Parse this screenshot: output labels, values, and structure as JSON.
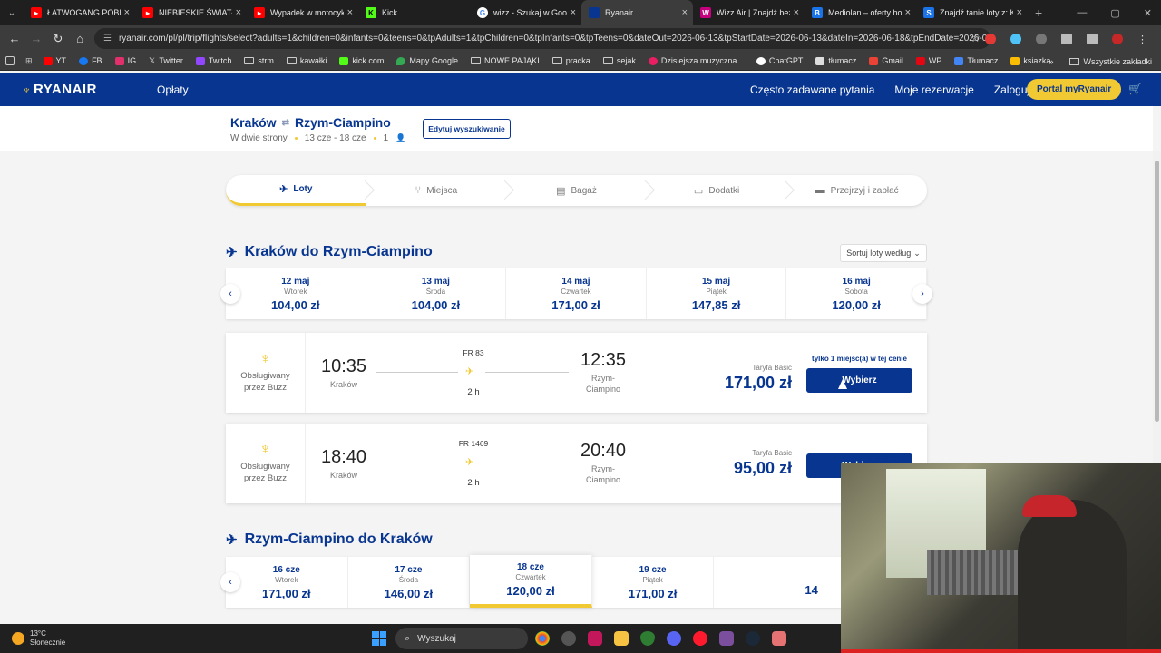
{
  "browser": {
    "tabs": [
      {
        "title": "ŁATWOGANG POBIŁ",
        "icon": "youtube-icon",
        "color": "#ff0000"
      },
      {
        "title": "NIEBIESKIE ŚWIATŁO",
        "icon": "youtube-icon",
        "color": "#ff0000"
      },
      {
        "title": "Wypadek w motocykl",
        "icon": "youtube-icon",
        "color": "#ff0000"
      },
      {
        "title": "Kick",
        "icon": "kick-icon",
        "color": "#53fc18"
      },
      {
        "title": "wizz - Szukaj w Goog",
        "icon": "google-icon",
        "color": "#ffffff"
      },
      {
        "title": "Ryanair",
        "icon": "ryanair-icon",
        "color": "#073590",
        "active": true
      },
      {
        "title": "Wizz Air | Znajdź bez",
        "icon": "wizzair-icon",
        "color": "#c6007e"
      },
      {
        "title": "Mediolan – oferty ho",
        "icon": "booking-icon",
        "color": "#1a73e8"
      },
      {
        "title": "Znajdź tanie loty z: K",
        "icon": "skyscanner-icon",
        "color": "#1a73e8"
      }
    ],
    "url": "ryanair.com/pl/pl/trip/flights/select?adults=1&children=0&infants=0&teens=0&tpAdults=1&tpChildren=0&tpInfants=0&tpTeens=0&dateOut=2026-06-13&tpStartDate=2026-06-13&dateIn=2026-06-18&tpEndDate=2026-0...",
    "bookmarks": [
      {
        "label": "YT",
        "icon": "youtube-icon",
        "color": "#ff0000"
      },
      {
        "label": "FB",
        "icon": "facebook-icon",
        "color": "#1877f2"
      },
      {
        "label": "IG",
        "icon": "instagram-icon",
        "color": "#e1306c"
      },
      {
        "label": "Twitter",
        "icon": "x-icon",
        "color": "#ffffff"
      },
      {
        "label": "Twitch",
        "icon": "twitch-icon",
        "color": "#9146ff"
      },
      {
        "label": "strm",
        "icon": "folder-icon",
        "color": ""
      },
      {
        "label": "kawałki",
        "icon": "folder-icon",
        "color": ""
      },
      {
        "label": "kick.com",
        "icon": "kick-icon",
        "color": "#53fc18"
      },
      {
        "label": "Mapy Google",
        "icon": "maps-icon",
        "color": "#34a853"
      },
      {
        "label": "NOWE PAJĄKI",
        "icon": "folder-icon",
        "color": ""
      },
      {
        "label": "pracka",
        "icon": "folder-icon",
        "color": ""
      },
      {
        "label": "sejak",
        "icon": "folder-icon",
        "color": ""
      },
      {
        "label": "Dzisiejsza muzyczna...",
        "icon": "music-icon",
        "color": "#e91e63"
      },
      {
        "label": "ChatGPT",
        "icon": "chatgpt-icon",
        "color": "#ffffff"
      },
      {
        "label": "tłumacz",
        "icon": "translate-icon",
        "color": "#ffffff"
      },
      {
        "label": "Gmail",
        "icon": "gmail-icon",
        "color": "#ea4335"
      },
      {
        "label": "WP",
        "icon": "wp-icon",
        "color": "#e30613"
      },
      {
        "label": "Tłumacz",
        "icon": "translate-icon",
        "color": "#4285f4"
      },
      {
        "label": "ksiazka",
        "icon": "book-icon",
        "color": "#fbbc04"
      }
    ],
    "all_bookmarks": "Wszystkie zakładki"
  },
  "header": {
    "logo": "RYANAIR",
    "fares_link": "Opłaty",
    "nav": [
      "Często zadawane pytania",
      "Moje rezerwacje",
      "Zaloguj się"
    ],
    "portal_button": "Portal myRyanair"
  },
  "trip": {
    "from": "Kraków",
    "to": "Rzym-Ciampino",
    "type": "W dwie strony",
    "dates": "13 cze - 18 cze",
    "passengers": "1",
    "edit_button": "Edytuj wyszukiwanie"
  },
  "steps": [
    {
      "label": "Loty",
      "icon": "plane-icon"
    },
    {
      "label": "Miejsca",
      "icon": "seat-icon"
    },
    {
      "label": "Bagaż",
      "icon": "luggage-icon"
    },
    {
      "label": "Dodatki",
      "icon": "extras-icon"
    },
    {
      "label": "Przejrzyj i zapłać",
      "icon": "card-icon"
    }
  ],
  "outbound": {
    "title": "Kraków do Rzym-Ciampino",
    "sort_label": "Sortuj loty według",
    "dates": [
      {
        "date": "12 maj",
        "day": "Wtorek",
        "price": "104,00 zł"
      },
      {
        "date": "13 maj",
        "day": "Środa",
        "price": "104,00 zł"
      },
      {
        "date": "14 maj",
        "day": "Czwartek",
        "price": "171,00 zł"
      },
      {
        "date": "15 maj",
        "day": "Piątek",
        "price": "147,85 zł"
      },
      {
        "date": "16 maj",
        "day": "Sobota",
        "price": "120,00 zł"
      }
    ],
    "flights": [
      {
        "operator": "Obsługiwany przez Buzz",
        "dep_time": "10:35",
        "dep_city": "Kraków",
        "flight_no": "FR 83",
        "duration": "2 h",
        "arr_time": "12:35",
        "arr_city": "Rzym-Ciampino",
        "fare_label": "Taryfa Basic",
        "price": "171,00 zł",
        "seats_note": "tylko 1 miejsc(a) w tej cenie",
        "select": "Wybierz"
      },
      {
        "operator": "Obsługiwany przez Buzz",
        "dep_time": "18:40",
        "dep_city": "Kraków",
        "flight_no": "FR 1469",
        "duration": "2 h",
        "arr_time": "20:40",
        "arr_city": "Rzym-Ciampino",
        "fare_label": "Taryfa Basic",
        "price": "95,00 zł",
        "select": "Wybierz"
      }
    ]
  },
  "inbound": {
    "title": "Rzym-Ciampino do Kraków",
    "dates": [
      {
        "date": "16 cze",
        "day": "Wtorek",
        "price": "171,00 zł"
      },
      {
        "date": "17 cze",
        "day": "Środa",
        "price": "146,00 zł"
      },
      {
        "date": "18 cze",
        "day": "Czwartek",
        "price": "120,00 zł",
        "selected": true
      },
      {
        "date": "19 cze",
        "day": "Piątek",
        "price": "171,00 zł"
      },
      {
        "date": "",
        "day": "",
        "price": "14"
      }
    ]
  },
  "taskbar": {
    "temp": "13°C",
    "weather": "Słonecznie",
    "search_placeholder": "Wyszukaj"
  },
  "colors": {
    "brand_blue": "#073590",
    "brand_yellow": "#f1c933"
  }
}
